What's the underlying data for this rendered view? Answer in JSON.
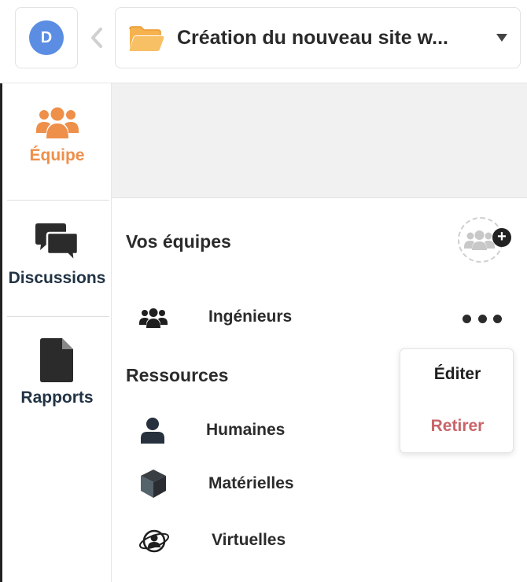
{
  "header": {
    "avatar_initial": "D",
    "project_title": "Création du nouveau site w...",
    "icons": {
      "back": "chevron-left-icon",
      "folder": "folder-icon",
      "caret": "caret-down-icon"
    }
  },
  "sidebar": {
    "items": [
      {
        "label": "Équipe",
        "icon": "team-icon",
        "active": true
      },
      {
        "label": "Discussions",
        "icon": "chat-bubbles-icon",
        "active": false
      },
      {
        "label": "Rapports",
        "icon": "document-icon",
        "active": false
      }
    ]
  },
  "main": {
    "teams": {
      "title": "Vos équipes",
      "add_icon": "add-team-icon",
      "items": [
        {
          "label": "Ingénieurs",
          "icon": "team-icon"
        }
      ]
    },
    "resources": {
      "title": "Ressources",
      "items": [
        {
          "label": "Humaines",
          "icon": "person-icon"
        },
        {
          "label": "Matérielles",
          "icon": "cube-icon"
        },
        {
          "label": "Virtuelles",
          "icon": "virtual-person-icon"
        }
      ]
    },
    "context_menu": {
      "edit_label": "Éditer",
      "remove_label": "Retirer"
    }
  },
  "colors": {
    "accent": "#ee8f4a",
    "avatar": "#5b8de3",
    "folder": "#f6b24e",
    "nav_text": "#213344",
    "danger": "#c9646a"
  }
}
